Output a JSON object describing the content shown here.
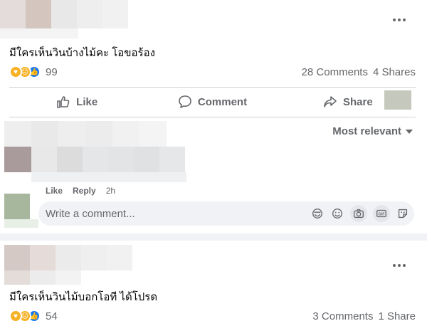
{
  "posts": [
    {
      "text": "มีใครเห็นวินบ้างไม้คะ โอขอร้อง",
      "reaction_count": "99",
      "comments": "28 Comments",
      "shares": "4 Shares",
      "actions": {
        "like": "Like",
        "comment": "Comment",
        "share": "Share"
      },
      "sort_label": "Most relevant",
      "comment_actions": {
        "like": "Like",
        "reply": "Reply",
        "time": "2h"
      },
      "composer_placeholder": "Write a comment..."
    },
    {
      "text": "มีใครเห็นวินไม้บอกโอที ได้โปรด",
      "reaction_count": "54",
      "comments": "3 Comments",
      "shares": "1 Share"
    }
  ],
  "reaction_icons": [
    "care-icon",
    "sad-icon",
    "like-icon"
  ],
  "composer_icons": [
    "sticker-icon",
    "emoji-icon",
    "camera-icon",
    "gif-icon",
    "sticker-square-icon"
  ],
  "colors": {
    "like_blue": "#1877f2",
    "emoji_yellow": "#f7b125",
    "secondary_text": "#65676b"
  }
}
